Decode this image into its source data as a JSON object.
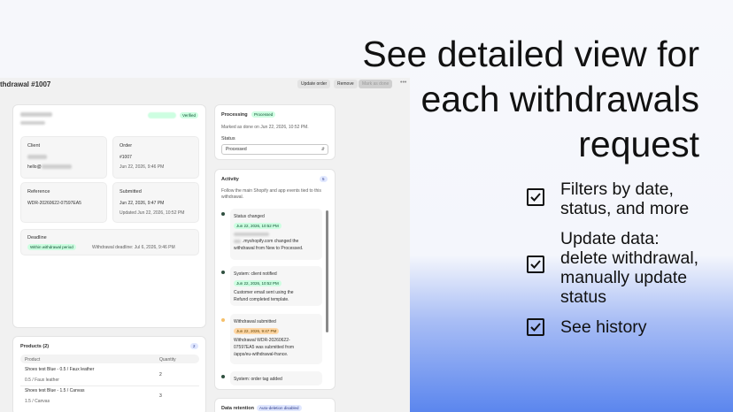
{
  "promo": {
    "headline_lines": [
      "See detailed view for",
      "each withdrawals",
      "request"
    ],
    "features": [
      {
        "lines": [
          "Filters by date,",
          "status, and more"
        ]
      },
      {
        "lines": [
          "Update data:",
          "delete withdrawal,",
          "manually update",
          "status"
        ]
      },
      {
        "lines": [
          "See history"
        ]
      }
    ]
  },
  "app": {
    "title": "thdrawal #1007",
    "buttons": {
      "update": "Update order",
      "remove": "Remove",
      "mark_done": "Mark as done"
    },
    "more": "•••",
    "header_badges": {
      "verified": "Verified"
    },
    "client": {
      "label": "Client",
      "email_prefix": "hello@"
    },
    "order": {
      "label": "Order",
      "number": "#1007",
      "date": "Jun 22, 2026, 9:46 PM"
    },
    "reference": {
      "label": "Reference",
      "value": "WDR-20260622-07597EA5"
    },
    "submitted": {
      "label": "Submitted",
      "date": "Jun 22, 2026, 9:47 PM",
      "updated": "Updated Jun 22, 2026, 10:52 PM"
    },
    "deadline": {
      "label": "Deadline",
      "badge": "Within withdrawal period",
      "text": "Withdrawal deadline: Jul 6, 2026, 9:46 PM"
    },
    "products": {
      "title": "Products (2)",
      "count_badge": "2",
      "col_product": "Product",
      "col_quantity": "Quantity",
      "rows": [
        {
          "name": "Shoes test Blue - 0.5 / Faux leather",
          "variant": "0.5 / Faux leather",
          "qty": "2"
        },
        {
          "name": "Shoes test Blue - 1.5 / Canvas",
          "variant": "1.5 / Canvas",
          "qty": "3"
        }
      ]
    },
    "processing": {
      "label": "Processing",
      "badge": "Processed",
      "note": "Marked as done on Jun 22, 2026, 10:52 PM.",
      "status_label": "Status",
      "status_value": "Processed"
    },
    "activity": {
      "label": "Activity",
      "count": "5",
      "desc": "Follow the main Shopify and app events tied to this withdrawal.",
      "events": [
        {
          "title": "Status changed",
          "date": "Jun 22, 2026, 10:52 PM",
          "line1": ".myshopify.com changed the",
          "line2": "withdrawal from New to Processed."
        },
        {
          "title": "System: client notified",
          "date": "Jun 22, 2026, 10:52 PM",
          "line1": "Customer email sent using the",
          "line2": "Refund completed template."
        },
        {
          "title": "Withdrawal submitted",
          "date": "Jun 22, 2026, 9:47 PM",
          "line1": "Withdrawal WDR-20260622-",
          "line2": "07597EA5 was submitted from",
          "line3": "/apps/eu-withdrawal-france."
        },
        {
          "title": "System: order tag added"
        }
      ]
    },
    "retention": {
      "label": "Data retention",
      "badge": "Auto-deletion disabled"
    }
  },
  "colors": {
    "accent_green": "#cdfee1",
    "accent_orange": "#ffd6a4",
    "gradient_blue": "#5b86ee"
  },
  "icons": {
    "checkbox": "checkbox-checked-icon",
    "chevron": "chevron-updown-icon"
  }
}
